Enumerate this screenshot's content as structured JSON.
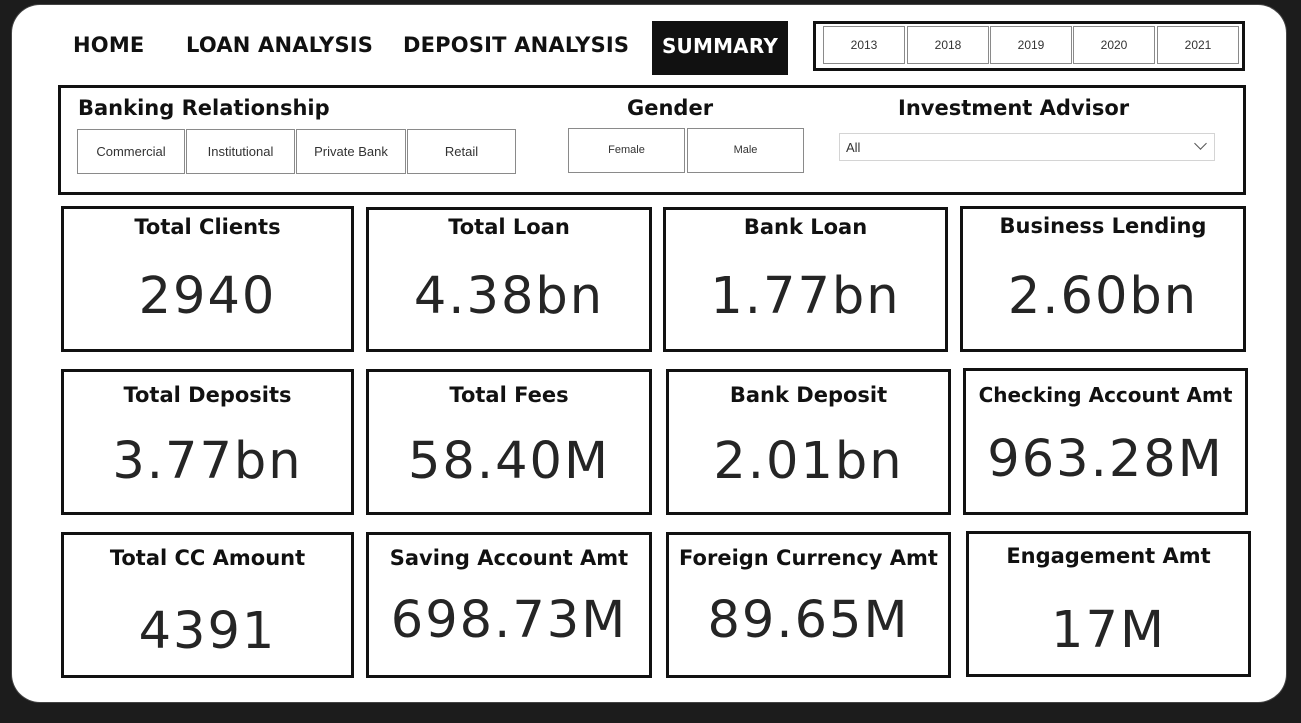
{
  "nav": {
    "home": "HOME",
    "loan_analysis": "LOAN ANALYSIS",
    "deposit_analysis": "DEPOSIT ANALYSIS",
    "summary": "SUMMARY"
  },
  "years": [
    "2013",
    "2018",
    "2019",
    "2020",
    "2021"
  ],
  "filters": {
    "banking_relationship": {
      "title": "Banking Relationship",
      "options": [
        "Commercial",
        "Institutional",
        "Private Bank",
        "Retail"
      ]
    },
    "gender": {
      "title": "Gender",
      "options": [
        "Female",
        "Male"
      ]
    },
    "investment_advisor": {
      "title": "Investment Advisor",
      "selected": "All"
    }
  },
  "cards": [
    {
      "title": "Total Clients",
      "value": "2940"
    },
    {
      "title": "Total Loan",
      "value": "4.38bn"
    },
    {
      "title": "Bank Loan",
      "value": "1.77bn"
    },
    {
      "title": "Business Lending",
      "value": "2.60bn"
    },
    {
      "title": "Total Deposits",
      "value": "3.77bn"
    },
    {
      "title": "Total Fees",
      "value": "58.40M"
    },
    {
      "title": "Bank Deposit",
      "value": "2.01bn"
    },
    {
      "title": "Checking Account Amt",
      "value": "963.28M"
    },
    {
      "title": "Total CC Amount",
      "value": "4391"
    },
    {
      "title": "Saving Account Amt",
      "value": "698.73M"
    },
    {
      "title": "Foreign Currency Amt",
      "value": "89.65M"
    },
    {
      "title": "Engagement Amt",
      "value": "17M"
    }
  ],
  "icons": {
    "dropdown": "chevron-down-icon"
  }
}
